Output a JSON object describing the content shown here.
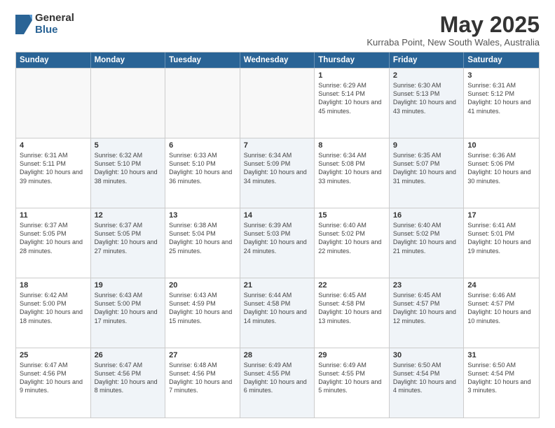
{
  "logo": {
    "general": "General",
    "blue": "Blue"
  },
  "title": "May 2025",
  "location": "Kurraba Point, New South Wales, Australia",
  "headers": [
    "Sunday",
    "Monday",
    "Tuesday",
    "Wednesday",
    "Thursday",
    "Friday",
    "Saturday"
  ],
  "weeks": [
    [
      {
        "day": "",
        "info": "",
        "empty": true
      },
      {
        "day": "",
        "info": "",
        "empty": true
      },
      {
        "day": "",
        "info": "",
        "empty": true
      },
      {
        "day": "",
        "info": "",
        "empty": true
      },
      {
        "day": "1",
        "info": "Sunrise: 6:29 AM\nSunset: 5:14 PM\nDaylight: 10 hours\nand 45 minutes.",
        "empty": false,
        "shaded": false
      },
      {
        "day": "2",
        "info": "Sunrise: 6:30 AM\nSunset: 5:13 PM\nDaylight: 10 hours\nand 43 minutes.",
        "empty": false,
        "shaded": true
      },
      {
        "day": "3",
        "info": "Sunrise: 6:31 AM\nSunset: 5:12 PM\nDaylight: 10 hours\nand 41 minutes.",
        "empty": false,
        "shaded": false
      }
    ],
    [
      {
        "day": "4",
        "info": "Sunrise: 6:31 AM\nSunset: 5:11 PM\nDaylight: 10 hours\nand 39 minutes.",
        "empty": false,
        "shaded": false
      },
      {
        "day": "5",
        "info": "Sunrise: 6:32 AM\nSunset: 5:10 PM\nDaylight: 10 hours\nand 38 minutes.",
        "empty": false,
        "shaded": true
      },
      {
        "day": "6",
        "info": "Sunrise: 6:33 AM\nSunset: 5:10 PM\nDaylight: 10 hours\nand 36 minutes.",
        "empty": false,
        "shaded": false
      },
      {
        "day": "7",
        "info": "Sunrise: 6:34 AM\nSunset: 5:09 PM\nDaylight: 10 hours\nand 34 minutes.",
        "empty": false,
        "shaded": true
      },
      {
        "day": "8",
        "info": "Sunrise: 6:34 AM\nSunset: 5:08 PM\nDaylight: 10 hours\nand 33 minutes.",
        "empty": false,
        "shaded": false
      },
      {
        "day": "9",
        "info": "Sunrise: 6:35 AM\nSunset: 5:07 PM\nDaylight: 10 hours\nand 31 minutes.",
        "empty": false,
        "shaded": true
      },
      {
        "day": "10",
        "info": "Sunrise: 6:36 AM\nSunset: 5:06 PM\nDaylight: 10 hours\nand 30 minutes.",
        "empty": false,
        "shaded": false
      }
    ],
    [
      {
        "day": "11",
        "info": "Sunrise: 6:37 AM\nSunset: 5:05 PM\nDaylight: 10 hours\nand 28 minutes.",
        "empty": false,
        "shaded": false
      },
      {
        "day": "12",
        "info": "Sunrise: 6:37 AM\nSunset: 5:05 PM\nDaylight: 10 hours\nand 27 minutes.",
        "empty": false,
        "shaded": true
      },
      {
        "day": "13",
        "info": "Sunrise: 6:38 AM\nSunset: 5:04 PM\nDaylight: 10 hours\nand 25 minutes.",
        "empty": false,
        "shaded": false
      },
      {
        "day": "14",
        "info": "Sunrise: 6:39 AM\nSunset: 5:03 PM\nDaylight: 10 hours\nand 24 minutes.",
        "empty": false,
        "shaded": true
      },
      {
        "day": "15",
        "info": "Sunrise: 6:40 AM\nSunset: 5:02 PM\nDaylight: 10 hours\nand 22 minutes.",
        "empty": false,
        "shaded": false
      },
      {
        "day": "16",
        "info": "Sunrise: 6:40 AM\nSunset: 5:02 PM\nDaylight: 10 hours\nand 21 minutes.",
        "empty": false,
        "shaded": true
      },
      {
        "day": "17",
        "info": "Sunrise: 6:41 AM\nSunset: 5:01 PM\nDaylight: 10 hours\nand 19 minutes.",
        "empty": false,
        "shaded": false
      }
    ],
    [
      {
        "day": "18",
        "info": "Sunrise: 6:42 AM\nSunset: 5:00 PM\nDaylight: 10 hours\nand 18 minutes.",
        "empty": false,
        "shaded": false
      },
      {
        "day": "19",
        "info": "Sunrise: 6:43 AM\nSunset: 5:00 PM\nDaylight: 10 hours\nand 17 minutes.",
        "empty": false,
        "shaded": true
      },
      {
        "day": "20",
        "info": "Sunrise: 6:43 AM\nSunset: 4:59 PM\nDaylight: 10 hours\nand 15 minutes.",
        "empty": false,
        "shaded": false
      },
      {
        "day": "21",
        "info": "Sunrise: 6:44 AM\nSunset: 4:58 PM\nDaylight: 10 hours\nand 14 minutes.",
        "empty": false,
        "shaded": true
      },
      {
        "day": "22",
        "info": "Sunrise: 6:45 AM\nSunset: 4:58 PM\nDaylight: 10 hours\nand 13 minutes.",
        "empty": false,
        "shaded": false
      },
      {
        "day": "23",
        "info": "Sunrise: 6:45 AM\nSunset: 4:57 PM\nDaylight: 10 hours\nand 12 minutes.",
        "empty": false,
        "shaded": true
      },
      {
        "day": "24",
        "info": "Sunrise: 6:46 AM\nSunset: 4:57 PM\nDaylight: 10 hours\nand 10 minutes.",
        "empty": false,
        "shaded": false
      }
    ],
    [
      {
        "day": "25",
        "info": "Sunrise: 6:47 AM\nSunset: 4:56 PM\nDaylight: 10 hours\nand 9 minutes.",
        "empty": false,
        "shaded": false
      },
      {
        "day": "26",
        "info": "Sunrise: 6:47 AM\nSunset: 4:56 PM\nDaylight: 10 hours\nand 8 minutes.",
        "empty": false,
        "shaded": true
      },
      {
        "day": "27",
        "info": "Sunrise: 6:48 AM\nSunset: 4:56 PM\nDaylight: 10 hours\nand 7 minutes.",
        "empty": false,
        "shaded": false
      },
      {
        "day": "28",
        "info": "Sunrise: 6:49 AM\nSunset: 4:55 PM\nDaylight: 10 hours\nand 6 minutes.",
        "empty": false,
        "shaded": true
      },
      {
        "day": "29",
        "info": "Sunrise: 6:49 AM\nSunset: 4:55 PM\nDaylight: 10 hours\nand 5 minutes.",
        "empty": false,
        "shaded": false
      },
      {
        "day": "30",
        "info": "Sunrise: 6:50 AM\nSunset: 4:54 PM\nDaylight: 10 hours\nand 4 minutes.",
        "empty": false,
        "shaded": true
      },
      {
        "day": "31",
        "info": "Sunrise: 6:50 AM\nSunset: 4:54 PM\nDaylight: 10 hours\nand 3 minutes.",
        "empty": false,
        "shaded": false
      }
    ]
  ]
}
